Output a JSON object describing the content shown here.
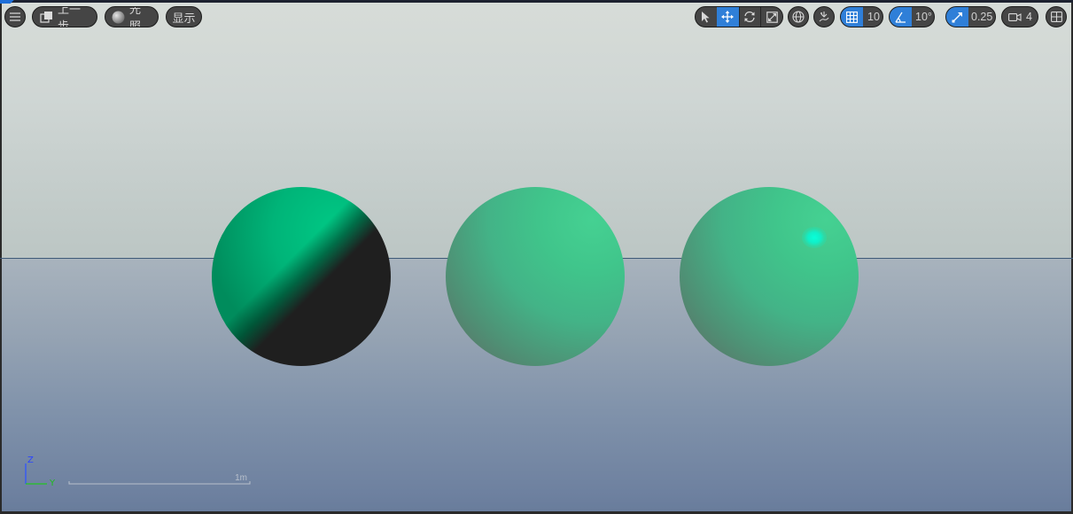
{
  "toolbar": {
    "left": {
      "menu_icon": "hamburger-menu-icon",
      "undo_label": "上一步",
      "lighting_label": "光照",
      "display_label": "显示"
    },
    "right": {
      "transform_tools": [
        "select-arrow-icon",
        "move-icon",
        "rotate-icon",
        "scale-icon"
      ],
      "active_tool": "move-icon",
      "grid_snap_value": "10",
      "angle_snap_value": "10°",
      "scale_snap_value": "0.25",
      "camera_speed_value": "4"
    }
  },
  "scene": {
    "spheres": [
      "unlit-sphere",
      "diffuse-sphere",
      "specular-sphere"
    ],
    "sphere_color": "#00c080",
    "sky_color": "#d7dcd8",
    "ground_color": "#6d809f"
  },
  "gizmo": {
    "z_label": "Z",
    "y_label": "Y",
    "scale_label": "1m"
  },
  "colors": {
    "accent": "#2f7fd8",
    "toolbar_bg": "#454545"
  }
}
